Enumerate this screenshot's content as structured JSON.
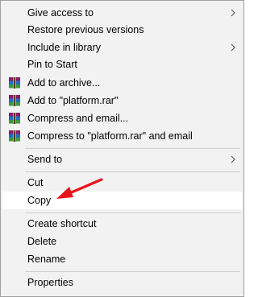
{
  "menu": {
    "items": [
      {
        "label": "Give access to",
        "icon": "none",
        "submenu": true
      },
      {
        "label": "Restore previous versions",
        "icon": "none",
        "submenu": false
      },
      {
        "label": "Include in library",
        "icon": "none",
        "submenu": true
      },
      {
        "label": "Pin to Start",
        "icon": "none",
        "submenu": false
      },
      {
        "label": "Add to archive...",
        "icon": "winrar-icon",
        "submenu": false
      },
      {
        "label": "Add to \"platform.rar\"",
        "icon": "winrar-icon",
        "submenu": false
      },
      {
        "label": "Compress and email...",
        "icon": "winrar-icon",
        "submenu": false
      },
      {
        "label": "Compress to \"platform.rar\" and email",
        "icon": "winrar-icon",
        "submenu": false
      },
      {
        "label": "Send to",
        "icon": "none",
        "submenu": true
      },
      {
        "label": "Cut",
        "icon": "none",
        "submenu": false
      },
      {
        "label": "Copy",
        "icon": "none",
        "submenu": false,
        "highlighted": true
      },
      {
        "label": "Create shortcut",
        "icon": "none",
        "submenu": false
      },
      {
        "label": "Delete",
        "icon": "none",
        "submenu": false
      },
      {
        "label": "Rename",
        "icon": "none",
        "submenu": false
      },
      {
        "label": "Properties",
        "icon": "none",
        "submenu": false
      }
    ]
  },
  "annotation": {
    "icon": "red-arrow-icon",
    "color": "#e8141b",
    "points_to": "Copy"
  },
  "colors": {
    "menu_bg": "#f2f2f2",
    "border": "#a0a0a0",
    "separator": "#cfcfcf",
    "highlight": "#ffffff"
  }
}
